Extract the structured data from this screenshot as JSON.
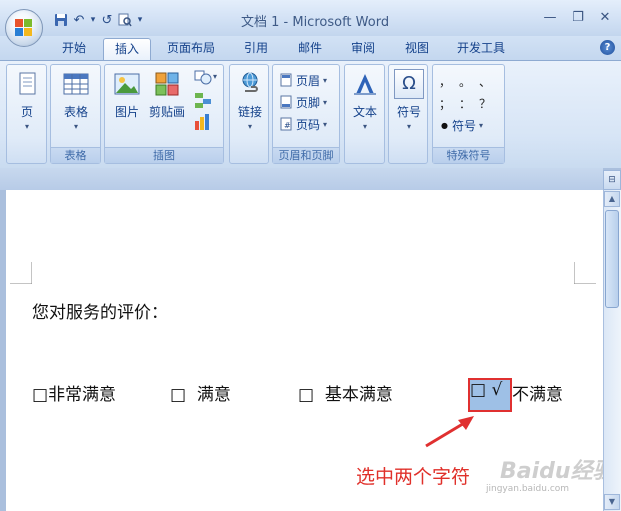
{
  "window": {
    "title": "文档 1 - Microsoft Word",
    "minimize_glyph": "—",
    "restore_glyph": "❐",
    "close_glyph": "✕"
  },
  "quick_access": {
    "save_glyph": "💾",
    "undo_glyph": "↶",
    "dropdown_glyph": "▾",
    "redo_glyph": "↺",
    "preview_glyph": "🔍",
    "customize_glyph": "▾"
  },
  "tabs": [
    {
      "label": "开始",
      "active": false
    },
    {
      "label": "插入",
      "active": true
    },
    {
      "label": "页面布局",
      "active": false
    },
    {
      "label": "引用",
      "active": false
    },
    {
      "label": "邮件",
      "active": false
    },
    {
      "label": "审阅",
      "active": false
    },
    {
      "label": "视图",
      "active": false
    },
    {
      "label": "开发工具",
      "active": false
    }
  ],
  "help_glyph": "?",
  "ribbon": {
    "page_group": {
      "button": "页",
      "label": ""
    },
    "table_group": {
      "button": "表格",
      "label": "表格"
    },
    "illustrations_group": {
      "picture": "图片",
      "clipart": "剪贴画",
      "label": "插图"
    },
    "links_group": {
      "button": "链接",
      "label": ""
    },
    "header_footer_group": {
      "header": "页眉",
      "footer": "页脚",
      "page_number": "页码",
      "label": "页眉和页脚"
    },
    "text_group": {
      "button": "文本",
      "label": ""
    },
    "symbols_group": {
      "button": "符号",
      "glyph": "Ω",
      "label": ""
    },
    "special_symbols_group": {
      "symbols": [
        "，",
        "。",
        "、",
        "；",
        "：",
        "？"
      ],
      "bullet": "●",
      "dropdown": "符号",
      "label": "特殊符号"
    },
    "dropdown_arrow": "▾"
  },
  "document": {
    "question": "您对服务的评价：",
    "options": [
      {
        "box": "□",
        "label": "非常满意"
      },
      {
        "box": "□",
        "label": "满意"
      },
      {
        "box": "□",
        "label": "基本满意"
      },
      {
        "box": "□",
        "label": "不满意"
      }
    ],
    "selected_text": "□ √",
    "check_mark": "√"
  },
  "annotation": {
    "text": "选中两个字符",
    "color": "#e0302a"
  },
  "watermark": {
    "brand": "Baidu经验",
    "url": "jingyan.baidu.com"
  },
  "scrollbar": {
    "up_glyph": "▲",
    "down_glyph": "▼",
    "ruler_glyph": "⊟"
  },
  "colors": {
    "ribbon_text": "#15428b",
    "selection": "#9ec0e6",
    "highlight_border": "#e03030"
  }
}
